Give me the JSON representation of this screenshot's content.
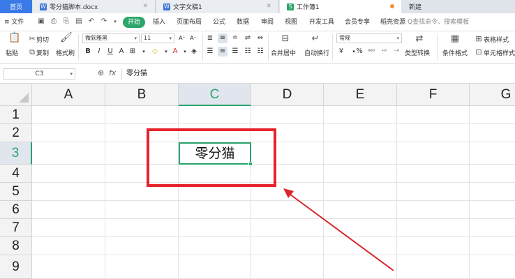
{
  "tabs": [
    {
      "label": "首页",
      "active": false
    },
    {
      "label": "零分猫脚本.docx",
      "icon": "word-doc-icon",
      "icon_text": "W",
      "closable": true
    },
    {
      "label": "文字文稿1",
      "icon": "word-doc-icon",
      "icon_text": "W",
      "closable": true
    },
    {
      "label": "工作簿1",
      "icon": "sheet-doc-icon",
      "icon_text": "S",
      "active": true,
      "unsaved": true
    },
    {
      "label": "新建"
    }
  ],
  "menubar": {
    "file": "≡ 文件",
    "start": "开始",
    "items": [
      "插入",
      "页面布局",
      "公式",
      "数据",
      "审阅",
      "视图",
      "开发工具",
      "会员专享",
      "稻壳资源"
    ],
    "search_placeholder": "Q查找命令、搜索模板"
  },
  "ribbon": {
    "cut": "剪切",
    "paste": "粘贴",
    "copy": "复制",
    "format_painter": "格式刷",
    "font_name": "微软雅黑",
    "font_size": "11",
    "merge_center": "合并居中",
    "wrap_text": "自动换行",
    "number_format": "常规",
    "type_convert": "类型转换",
    "conditional_format": "条件格式",
    "table_style": "表格样式",
    "cell_style": "单元格样式",
    "percent": "%",
    "thousands": "⁰⁰⁰",
    "dec_inc": "⁺⁰",
    "dec_dec": "⁻⁰"
  },
  "formula_bar": {
    "cell_ref": "C3",
    "fx": "fx",
    "value": "零分猫"
  },
  "grid": {
    "columns": [
      "A",
      "B",
      "C",
      "D",
      "E",
      "F",
      "G"
    ],
    "rows": [
      "1",
      "2",
      "3",
      "4",
      "5",
      "6",
      "7",
      "8",
      "9"
    ],
    "active_column": "C",
    "active_row": "3",
    "active_cell_value": "零分猫"
  },
  "colors": {
    "accent_green": "#2aa56d",
    "annotation_red": "#e5232b",
    "home_tab_blue": "#3a7ae8"
  }
}
